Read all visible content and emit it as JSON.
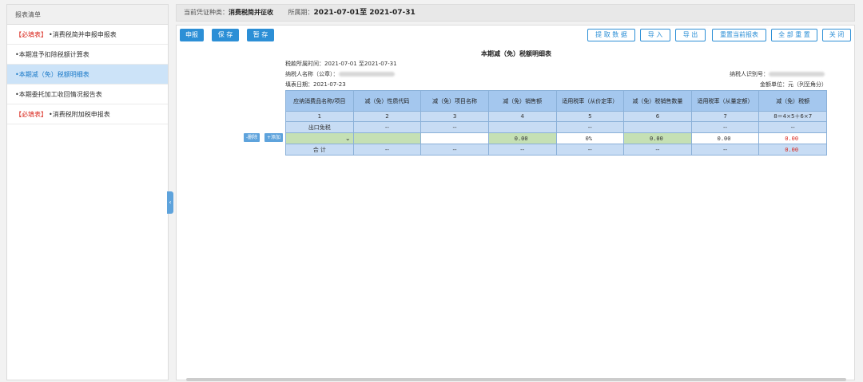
{
  "sidebar": {
    "title": "报表清单",
    "items": [
      {
        "req": "【必填表】",
        "label": "•消费税简并申报申报表"
      },
      {
        "req": "",
        "label": "•本期准予扣除税额计算表"
      },
      {
        "req": "",
        "label": "•本期减（免）税额明细表"
      },
      {
        "req": "",
        "label": "•本期委托加工收回情况报告表"
      },
      {
        "req": "【必填表】",
        "label": "•消费税附加税申报表"
      }
    ],
    "collapse": "‹"
  },
  "infobar": {
    "type_label": "当前凭证种类：",
    "type_value": "消费税简并征收",
    "period_label": "所属期：",
    "period_value": "2021-07-01至 2021-07-31"
  },
  "toolbar": {
    "declare": "申报",
    "save": "保 存",
    "temp_save": "暂 存",
    "fetch": "提 取 数 据",
    "import": "导 入",
    "export": "导 出",
    "reset_current": "重置当前报表",
    "reset_all": "全 部 重 置",
    "close": "关 闭"
  },
  "report": {
    "title": "本期减（免）税额明细表",
    "tax_period": "税款所属时间：2021-07-01 至2021-07-31",
    "taxpayer_name_label": "纳税人名称（公章）：",
    "taxpayer_id_label": "纳税人识别号：",
    "fill_date": "填表日期：2021-07-23",
    "unit": "金额单位：元（列至角分）"
  },
  "table": {
    "headers": [
      "应纳消费品名称/项目",
      "减（免）性质代码",
      "减（免）项目名称",
      "减（免）销售额",
      "适用税率（从价定率）",
      "减（免）税销售数量",
      "适用税率（从量定额）",
      "减（免）税额"
    ],
    "index_row": [
      "1",
      "2",
      "3",
      "4",
      "5",
      "6",
      "7",
      "8＝4×5＋6×7"
    ],
    "export_row": [
      "出口免税",
      "--",
      "--",
      "",
      "--",
      "",
      "--",
      "--"
    ],
    "data_row": {
      "c4": "0.00",
      "c5": "0%",
      "c6": "0.00",
      "c7": "0.00",
      "c8": "0.00"
    },
    "total_row": [
      "合 计",
      "--",
      "--",
      "--",
      "--",
      "--",
      "--",
      "0.00"
    ]
  },
  "row_actions": {
    "delete": "-删除",
    "add": "+添加"
  }
}
